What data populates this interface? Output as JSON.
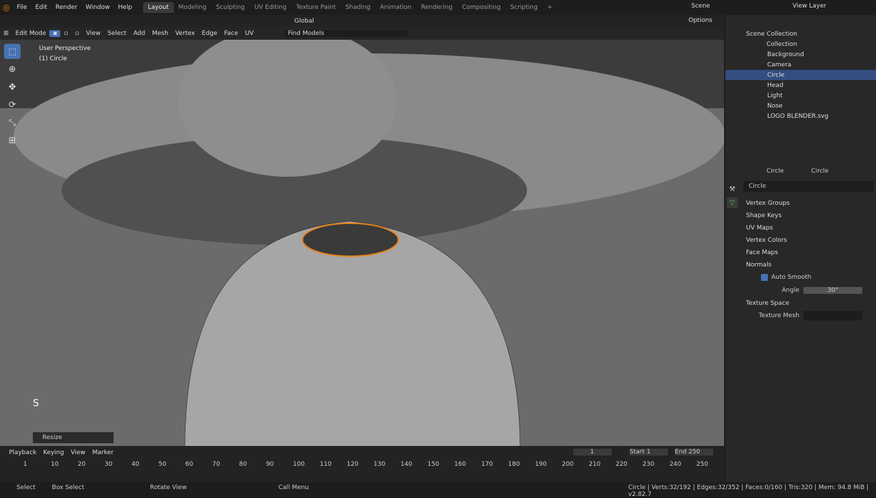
{
  "topbar": {
    "menus": [
      "File",
      "Edit",
      "Render",
      "Window",
      "Help"
    ],
    "workspaces": [
      "Layout",
      "Modeling",
      "Sculpting",
      "UV Editing",
      "Texture Paint",
      "Shading",
      "Animation",
      "Rendering",
      "Compositing",
      "Scripting"
    ],
    "scene": "Scene",
    "view_layer": "View Layer"
  },
  "vp_header": {
    "transform": "Global",
    "options": "Options",
    "mode": "Edit Mode",
    "menus": [
      "View",
      "Select",
      "Add",
      "Mesh",
      "Vertex",
      "Edge",
      "Face",
      "UV"
    ],
    "find": "Find Models"
  },
  "viewport": {
    "persp": "User Perspective",
    "object": "(1) Circle",
    "key": "S",
    "operator": "Resize"
  },
  "outliner": {
    "root": "Scene Collection",
    "items": [
      "Collection",
      "Background",
      "Camera",
      "Circle",
      "Head",
      "Light",
      "Nose",
      "LOGO BLENDER.svg"
    ]
  },
  "props": {
    "object": "Circle",
    "data": "Circle",
    "mesh": "Circle",
    "sections": [
      "Vertex Groups",
      "Shape Keys",
      "UV Maps",
      "Vertex Colors",
      "Face Maps",
      "Normals"
    ],
    "auto_smooth": "Auto Smooth",
    "angle_label": "Angle",
    "angle": "30°",
    "texture_space": "Texture Space",
    "texture_mesh": "Texture Mesh"
  },
  "timeline": {
    "menus": [
      "Playback",
      "Keying",
      "View",
      "Marker"
    ],
    "frame": "1",
    "start_label": "Start",
    "start": "1",
    "end_label": "End",
    "end": "250",
    "ticks": [
      "1",
      "10",
      "20",
      "30",
      "40",
      "50",
      "60",
      "70",
      "80",
      "90",
      "100",
      "110",
      "120",
      "130",
      "140",
      "150",
      "160",
      "170",
      "180",
      "190",
      "200",
      "210",
      "220",
      "230",
      "240",
      "250"
    ]
  },
  "status": {
    "select": "Select",
    "box": "Box Select",
    "rotate": "Rotate View",
    "call": "Call Menu",
    "stats": "Circle | Verts:32/192 | Edges:32/352 | Faces:0/160 | Tris:320 | Mem: 94.8 MiB | v2.82.7"
  }
}
